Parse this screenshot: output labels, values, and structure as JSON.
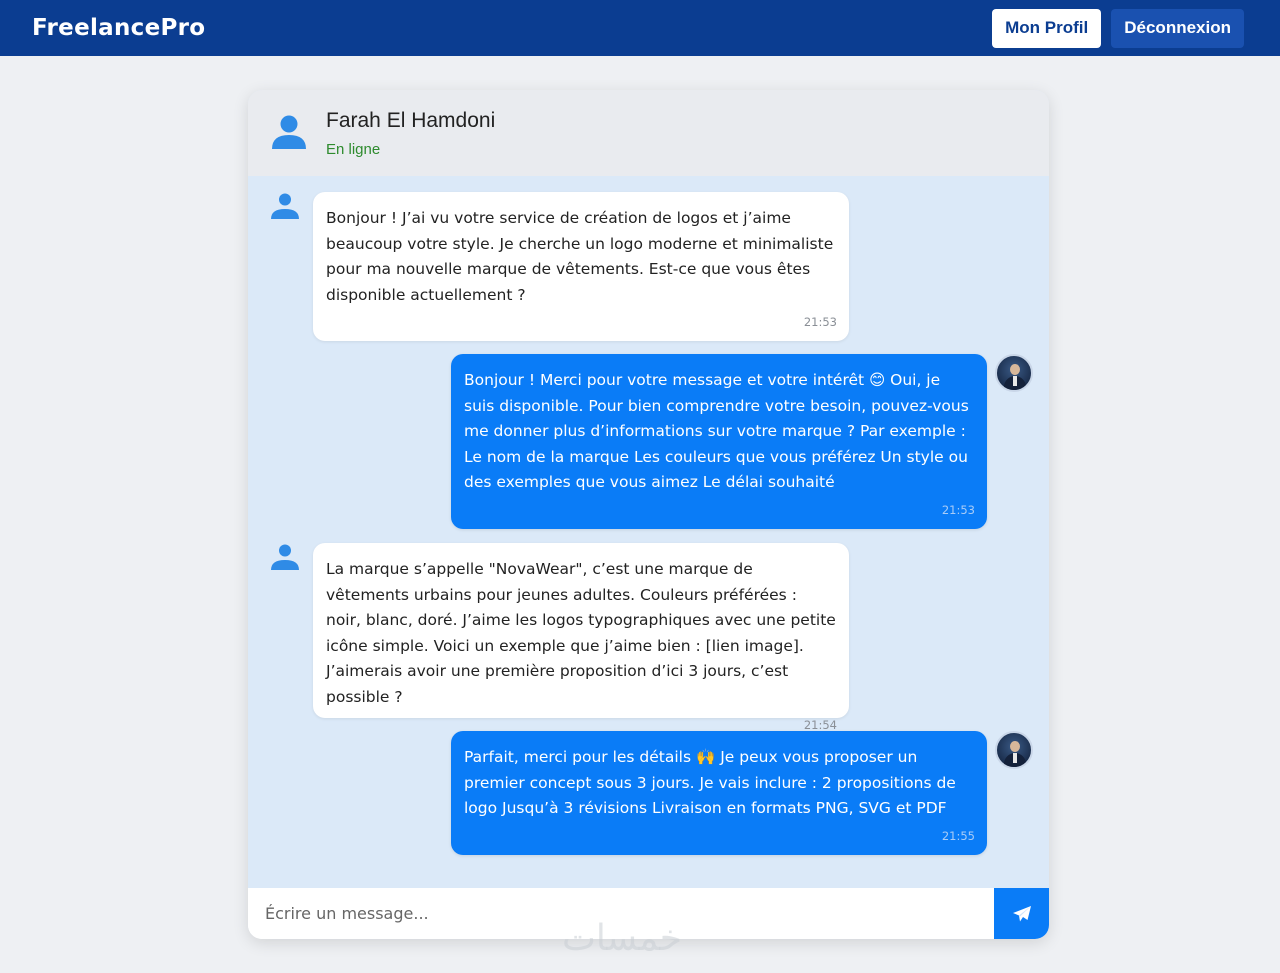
{
  "navbar": {
    "brand": "FreelancePro",
    "profile_label": "Mon Profil",
    "logout_label": "Déconnexion"
  },
  "chat": {
    "contact_name": "Farah El Hamdoni",
    "contact_status": "En ligne",
    "messages": [
      {
        "direction": "incoming",
        "text": "Bonjour ! J’ai vu votre service de création de logos et j’aime beaucoup votre style. Je cherche un logo moderne et minimaliste pour ma nouvelle marque de vêtements. Est-ce que vous êtes disponible actuellement ?",
        "time": "21:53"
      },
      {
        "direction": "outgoing",
        "text": "Bonjour ! Merci pour votre message et votre intérêt 😊 Oui, je suis disponible. Pour bien comprendre votre besoin, pouvez-vous me donner plus d’informations sur votre marque ? Par exemple : Le nom de la marque Les couleurs que vous préférez Un style ou des exemples que vous aimez Le délai souhaité",
        "time": "21:53"
      },
      {
        "direction": "incoming",
        "text": "La marque s’appelle \"NovaWear\", c’est une marque de vêtements urbains pour jeunes adultes. Couleurs préférées : noir, blanc, doré. J’aime les logos typographiques avec une petite icône simple. Voici un exemple que j’aime bien : [lien image]. J’aimerais avoir une première proposition d’ici 3 jours, c’est possible ?",
        "time": "21:54"
      },
      {
        "direction": "outgoing",
        "text": "Parfait, merci pour les détails 🙌 Je peux vous proposer un premier concept sous 3 jours. Je vais inclure : 2 propositions de logo Jusqu’à 3 révisions Livraison en formats PNG, SVG et PDF",
        "time": "21:55"
      }
    ],
    "input_placeholder": "Écrire un message...",
    "send_icon": "paper-plane-icon"
  },
  "watermark": "خمسات",
  "colors": {
    "navbar": "#0b3d91",
    "outgoing_bubble": "#0a7cf7",
    "chat_background": "#dbe9f8",
    "status_online": "#2e8b2e"
  }
}
